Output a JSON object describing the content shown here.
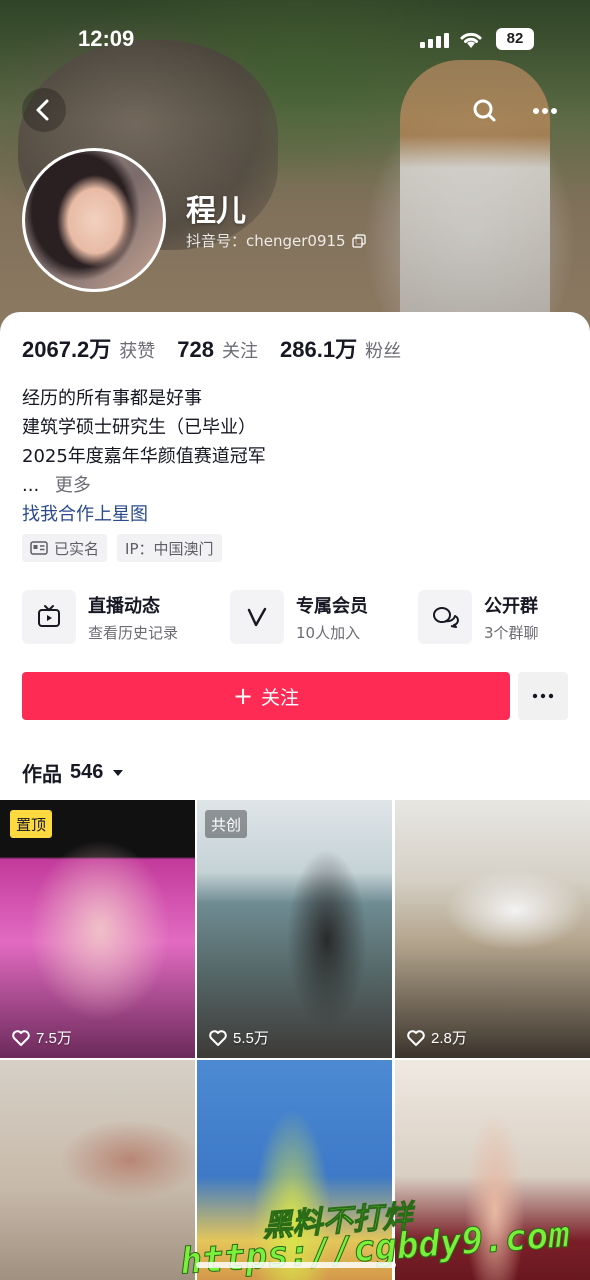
{
  "status_bar": {
    "time": "12:09",
    "battery": "82"
  },
  "profile": {
    "name": "程儿",
    "douyin_id": "抖音号：chenger0915"
  },
  "stats": [
    {
      "value": "2067.2万",
      "label": "获赞"
    },
    {
      "value": "728",
      "label": "关注"
    },
    {
      "value": "286.1万",
      "label": "粉丝"
    }
  ],
  "bio": {
    "lines": [
      "经历的所有事都是好事",
      "建筑学硕士研究生（已毕业）",
      "2025年度嘉年华颜值赛道冠军"
    ],
    "ellipsis": "...",
    "more": "更多",
    "link": "找我合作上星图"
  },
  "tags": [
    {
      "icon": "id-card-icon",
      "label": "已实名"
    },
    {
      "label": "IP：中国澳门"
    }
  ],
  "features": [
    {
      "icon": "tv-icon",
      "title": "直播动态",
      "subtitle": "查看历史记录"
    },
    {
      "icon": "v-icon",
      "title": "专属会员",
      "subtitle": "10人加入"
    },
    {
      "icon": "chat-icon",
      "title": "公开群",
      "subtitle": "3个群聊"
    }
  ],
  "follow_button": {
    "label": "关注",
    "plus": "+"
  },
  "works_tab": {
    "label": "作品",
    "count": "546"
  },
  "videos": [
    {
      "badge": "置顶",
      "likes": "7.5万"
    },
    {
      "badge": "共创",
      "likes": "5.5万"
    },
    {
      "likes": "2.8万"
    },
    {},
    {},
    {}
  ],
  "watermark": {
    "line1": "黑料不打烊",
    "line2": "https://cgbdy9.com"
  }
}
